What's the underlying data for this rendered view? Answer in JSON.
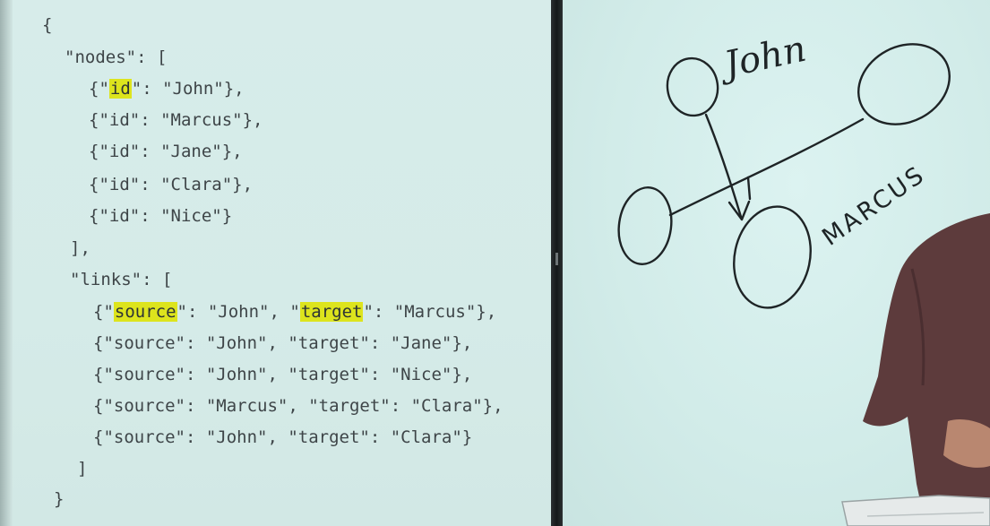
{
  "code": {
    "open_brace": "{",
    "nodes_key_line": "\"nodes\": [",
    "nodes": [
      {
        "pre": "{\"",
        "hl": "id",
        "post": "\": \"John\"},"
      },
      {
        "text": "{\"id\": \"Marcus\"},"
      },
      {
        "text": "{\"id\": \"Jane\"},"
      },
      {
        "text": "{\"id\": \"Clara\"},"
      },
      {
        "text": "{\"id\": \"Nice\"}"
      }
    ],
    "nodes_close": "],",
    "links_key_line": "\"links\": [",
    "links": {
      "first": {
        "pre": "{\"",
        "hl1": "source",
        "mid": "\": \"John\", \"",
        "hl2": "target",
        "post": "\": \"Marcus\"},"
      },
      "rest": [
        "{\"source\": \"John\", \"target\": \"Jane\"},",
        "{\"source\": \"John\", \"target\": \"Nice\"},",
        "{\"source\": \"Marcus\", \"target\": \"Clara\"},",
        "{\"source\": \"John\", \"target\": \"Clara\"}"
      ]
    },
    "links_close": "]",
    "close_brace": "}"
  },
  "whiteboard": {
    "labels": {
      "john": "John",
      "marcus": "MARCUS"
    }
  },
  "colors": {
    "highlight": "#dde41d",
    "code_text": "#3e4548",
    "ink": "#1e2426"
  }
}
